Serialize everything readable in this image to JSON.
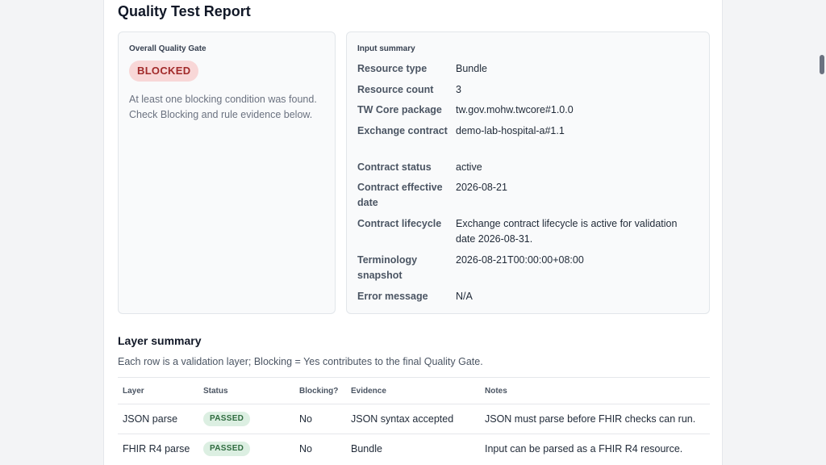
{
  "report": {
    "title": "Quality Test Report"
  },
  "gate": {
    "label": "Overall Quality Gate",
    "status": "BLOCKED",
    "description": "At least one blocking condition was found. Check Blocking and rule evidence below."
  },
  "input_summary": {
    "label": "Input summary",
    "rows": [
      {
        "key": "Resource type",
        "value": "Bundle"
      },
      {
        "key": "Resource count",
        "value": "3"
      },
      {
        "key": "TW Core package",
        "value": "tw.gov.mohw.twcore#1.0.0"
      },
      {
        "key": "Exchange contract",
        "value": "demo-lab-hospital-a#1.1"
      },
      {
        "key": "Contract status",
        "value": "active"
      },
      {
        "key": "Contract effective date",
        "value": "2026-08-21"
      },
      {
        "key": "Contract lifecycle",
        "value": "Exchange contract lifecycle is active for validation date 2026-08-31."
      },
      {
        "key": "Terminology snapshot",
        "value": "2026-08-21T00:00:00+08:00"
      },
      {
        "key": "Error message",
        "value": "N/A"
      }
    ]
  },
  "layer_summary": {
    "title": "Layer summary",
    "subtitle": "Each row is a validation layer; Blocking = Yes contributes to the final Quality Gate.",
    "columns": [
      "Layer",
      "Status",
      "Blocking?",
      "Evidence",
      "Notes"
    ],
    "rows": [
      {
        "layer": "JSON parse",
        "status": "PASSED",
        "blocking": "No",
        "evidence": "JSON syntax accepted",
        "notes": "JSON must parse before FHIR checks can run."
      },
      {
        "layer": "FHIR R4 parse",
        "status": "PASSED",
        "blocking": "No",
        "evidence": "Bundle",
        "notes": "Input can be parsed as a FHIR R4 resource."
      }
    ]
  }
}
